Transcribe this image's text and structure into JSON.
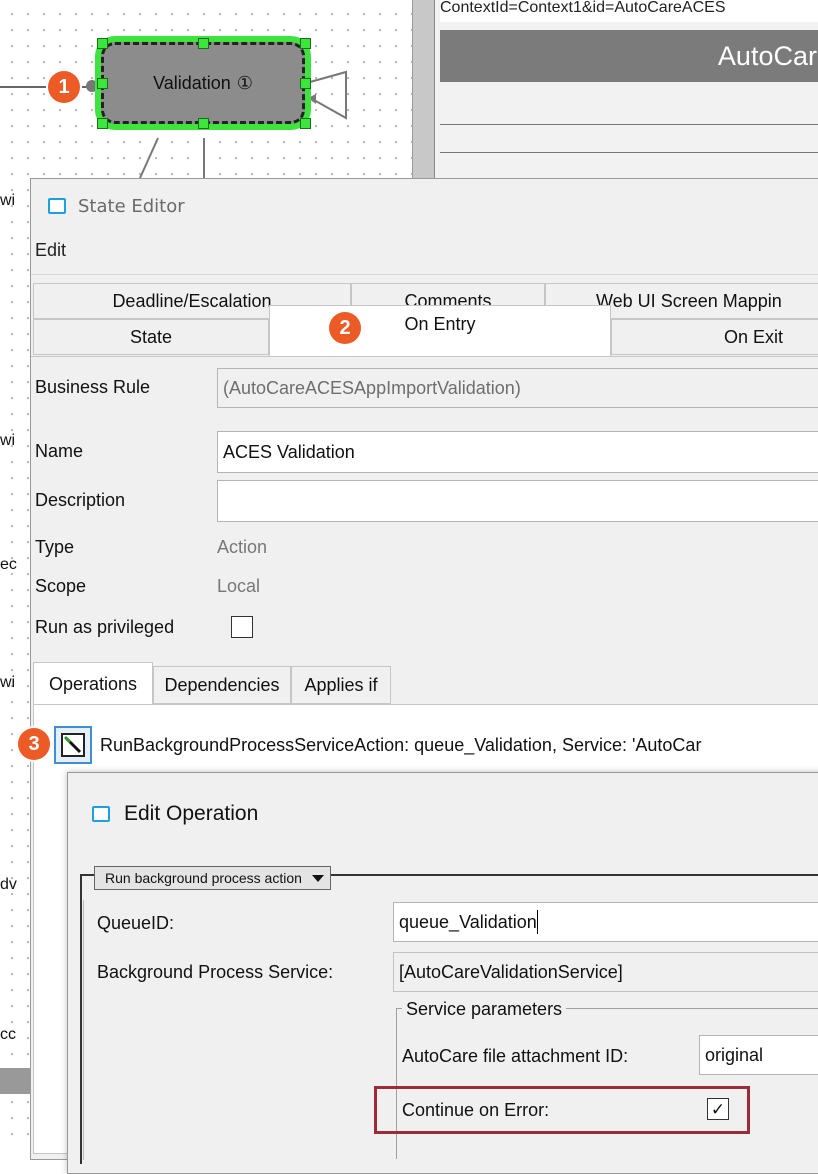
{
  "canvas": {
    "state_node_label": "Validation",
    "state_node_info_glyph": "①"
  },
  "right_panel": {
    "top_text": "ContextId=Context1&id=AutoCareACES",
    "header": "AutoCare"
  },
  "badges": {
    "one": "1",
    "two": "2",
    "three": "3"
  },
  "state_editor": {
    "title": "State Editor",
    "menu": [
      "Edit"
    ],
    "tabs_row1": [
      "Deadline/Escalation",
      "Comments",
      "Web UI Screen Mappin"
    ],
    "tabs_row2": [
      "State",
      "On Entry",
      "On Exit"
    ],
    "active_tab": "On Entry",
    "fields": {
      "business_rule_label": "Business Rule",
      "business_rule_value": "(AutoCareACESAppImportValidation)",
      "name_label": "Name",
      "name_value": "ACES Validation",
      "description_label": "Description",
      "description_value": "",
      "type_label": "Type",
      "type_value": "Action",
      "scope_label": "Scope",
      "scope_value": "Local",
      "run_as_privileged_label": "Run as privileged",
      "run_as_privileged_checked": false
    },
    "subtabs": [
      "Operations",
      "Dependencies",
      "Applies if"
    ],
    "active_subtab": "Operations",
    "operations": [
      {
        "text": "RunBackgroundProcessServiceAction: queue_Validation, Service: 'AutoCar",
        "icon": "edit-operation-icon"
      }
    ]
  },
  "edit_operation": {
    "title": "Edit Operation",
    "action_dropdown": "Run background process action",
    "queue_id_label": "QueueID:",
    "queue_id_value": "queue_Validation",
    "bps_label": "Background Process Service:",
    "bps_value": "[AutoCareValidationService]",
    "service_parameters_label": "Service parameters",
    "attachment_label": "AutoCare file attachment ID:",
    "attachment_value": "original",
    "continue_label": "Continue on Error:",
    "continue_checked": true,
    "checkmark_glyph": "✓"
  },
  "colors": {
    "node_highlight": "#3ee33e",
    "badge": "#ec5a25",
    "callout_box": "#9b2b36",
    "window_icon": "#1ba1e2"
  },
  "side_fragments": [
    "wi",
    "wi",
    "ec",
    "wi",
    "dv",
    "cc"
  ]
}
